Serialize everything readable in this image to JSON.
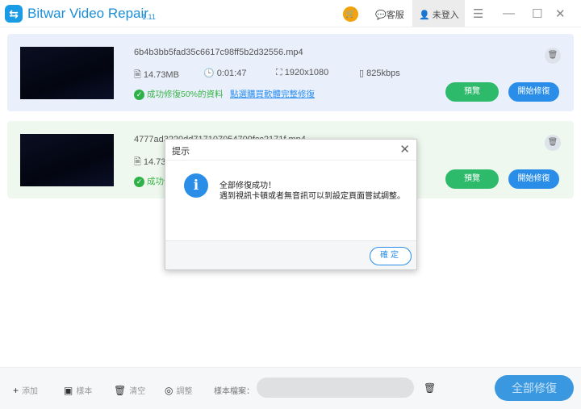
{
  "app": {
    "title": "Bitwar Video Repair",
    "version": "1.11"
  },
  "titlebar": {
    "support": "客服",
    "login": "未登入"
  },
  "files": [
    {
      "name": "6b4b3bb5fad35c6617c98ff5b2d32556.mp4",
      "size": "14.73MB",
      "duration": "0:01:47",
      "resolution": "1920x1080",
      "bitrate": "825kbps",
      "status": "成功修復50%的資料",
      "link": "點選購買軟體完整修復",
      "preview": "預覽",
      "start": "開始修復"
    },
    {
      "name": "4777ad3220dd717107054709fcc2171f.mp4",
      "size": "14.73MB",
      "status": "成功修復50%的資料",
      "preview": "預覽",
      "start": "開始修復"
    }
  ],
  "bottom": {
    "add": "添加",
    "sample": "樣本",
    "clear": "清空",
    "adjust": "調整",
    "sample_file": "樣本檔案：",
    "repair_all": "全部修復"
  },
  "dialog": {
    "title": "提示",
    "line1": "全部修復成功！",
    "line2": "遇到視訊卡頓或者無音訊可以到設定頁面嘗試調整。",
    "ok": "確定"
  }
}
